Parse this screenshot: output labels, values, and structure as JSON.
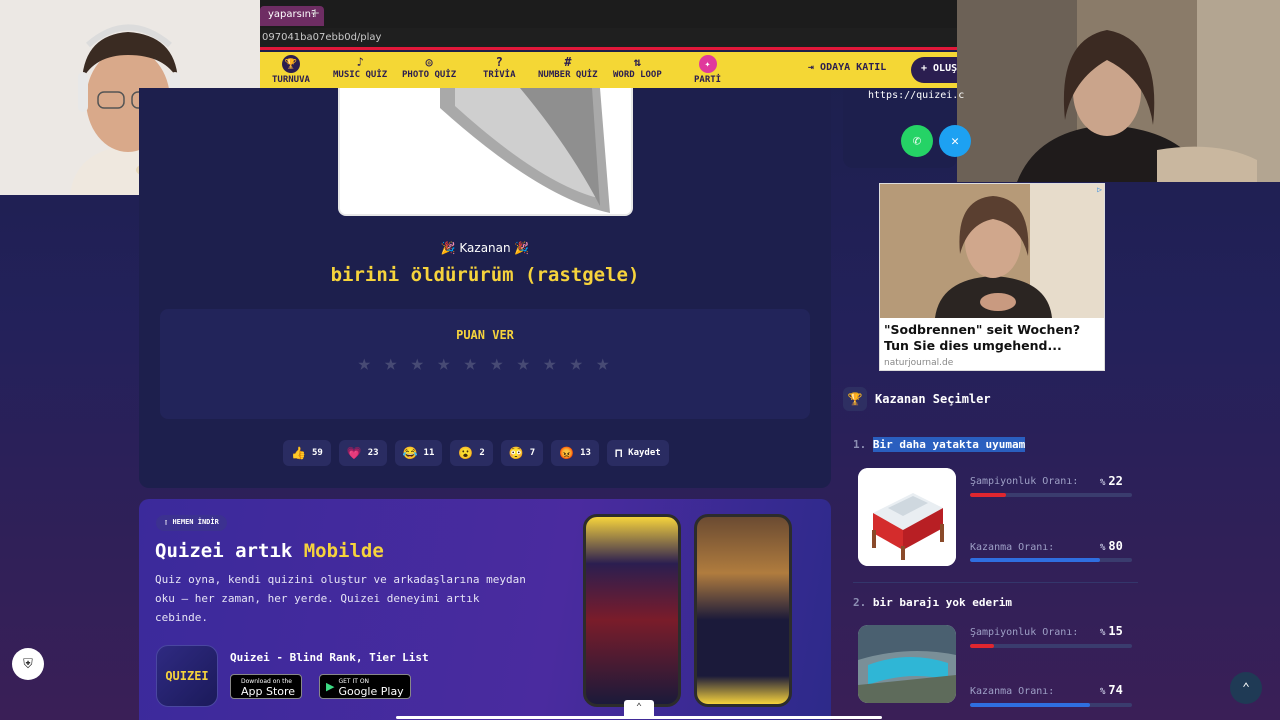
{
  "browser": {
    "tab_title": "yaparsın?",
    "tab_add": "+",
    "url": "097041ba07ebb0d/play"
  },
  "nav": {
    "items": [
      {
        "icon": "trophy-icon",
        "glyph": "🏆",
        "label": "TURNUVA"
      },
      {
        "icon": "music-icon",
        "glyph": "♪",
        "label": "MUSIC QUİZ"
      },
      {
        "icon": "camera-icon",
        "glyph": "◎",
        "label": "PHOTO QUİZ"
      },
      {
        "icon": "trivia-icon",
        "glyph": "?",
        "label": "TRİVİA"
      },
      {
        "icon": "hash-icon",
        "glyph": "#",
        "label": "NUMBER QUİZ"
      },
      {
        "icon": "loop-icon",
        "glyph": "⇅",
        "label": "WORD LOOP"
      },
      {
        "icon": "party-icon",
        "glyph": "✦",
        "label": "PARTİ"
      }
    ],
    "join_label": "ODAYA KATIL",
    "create_label": "+ OLUŞ"
  },
  "main": {
    "winner_label": "🎉  Kazanan  🎉",
    "winner_title": "birini öldürürüm (rastgele)",
    "rate_title": "PUAN VER",
    "star_count": 10,
    "reactions": [
      {
        "emoji": "👍",
        "count": "59"
      },
      {
        "emoji": "💗",
        "count": "23"
      },
      {
        "emoji": "😂",
        "count": "11"
      },
      {
        "emoji": "😮",
        "count": "2"
      },
      {
        "emoji": "😳",
        "count": "7"
      },
      {
        "emoji": "😡",
        "count": "13"
      }
    ],
    "save_label": "Kaydet"
  },
  "promo": {
    "badge": "HEMEN İNDİR",
    "title_prefix": "Quizei artık",
    "title_highlight": "Mobilde",
    "description": "Quiz oyna, kendi quizini oluştur ve arkadaşlarına meydan oku — her zaman, her yerde. Quizei deneyimi artık cebinde.",
    "app_icon_text": "QUIZEI",
    "app_name": "Quizei - Blind Rank, Tier List",
    "app_store_small": "Download on the",
    "app_store": "App Store",
    "play_store_small": "GET IT ON",
    "play_store": "Google Play"
  },
  "sidebar": {
    "share_url": "https://quizei.c",
    "ad": {
      "title": "\"Sodbrennen\" seit Wochen? Tun Sie dies umgehend...",
      "source": "naturjournal.de"
    },
    "section_title": "Kazanan Seçimler",
    "choices": [
      {
        "rank": "1.",
        "name": "Bir daha yatakta uyumam",
        "champion_label": "Şampiyonluk Oranı:",
        "champion_rate": 22,
        "win_label": "Kazanma Oranı:",
        "win_rate": 80
      },
      {
        "rank": "2.",
        "name": "bir barajı yok ederim",
        "champion_label": "Şampiyonluk Oranı:",
        "champion_rate": 15,
        "win_label": "Kazanma Oranı:",
        "win_rate": 74
      }
    ],
    "pct_symbol": "%"
  },
  "colors": {
    "accent_yellow": "#f6d33c",
    "nav_bg": "#f4d735",
    "champion_bar": "#e0262f",
    "win_bar": "#2f6fe0"
  }
}
